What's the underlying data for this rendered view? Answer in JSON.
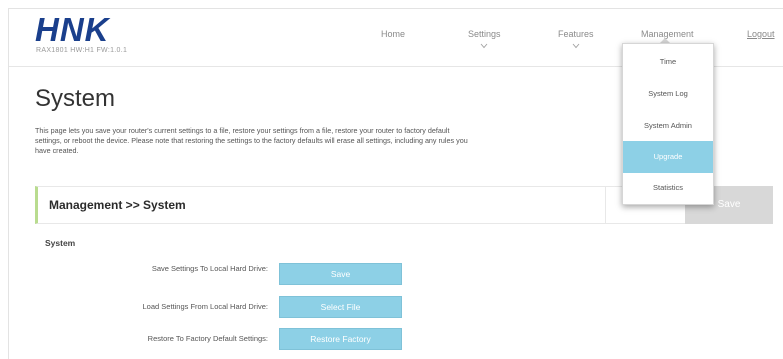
{
  "header": {
    "logo": "HNK",
    "firmware": "RAX1801 HW:H1 FW:1.0.1"
  },
  "nav": {
    "home": "Home",
    "settings": "Settings",
    "features": "Features",
    "management": "Management",
    "logout": "Logout"
  },
  "dropdown": {
    "items": [
      "Time",
      "System Log",
      "System Admin",
      "Upgrade",
      "Statistics"
    ],
    "active": "Upgrade"
  },
  "page": {
    "title": "System",
    "description": "This page lets you save your router's current settings to a file, restore your settings from a file, restore your router to factory default settings, or reboot the device. Please note that restoring the settings to the factory defaults will erase all settings, including any rules you have created."
  },
  "panel": {
    "title": "Management >> System",
    "apply_label": "Save"
  },
  "section": {
    "label": "System",
    "rows": [
      {
        "label": "Save Settings To Local Hard Drive:",
        "button": "Save"
      },
      {
        "label": "Load Settings From Local Hard Drive:",
        "button": "Select File"
      },
      {
        "label": "Restore To Factory Default Settings:",
        "button": "Restore Factory"
      }
    ]
  },
  "colors": {
    "brand": "#1a3f8c",
    "accent_button": "#8dd0e6",
    "panel_border": "#b9dc8f",
    "apply_disabled": "#d8d8d8"
  }
}
